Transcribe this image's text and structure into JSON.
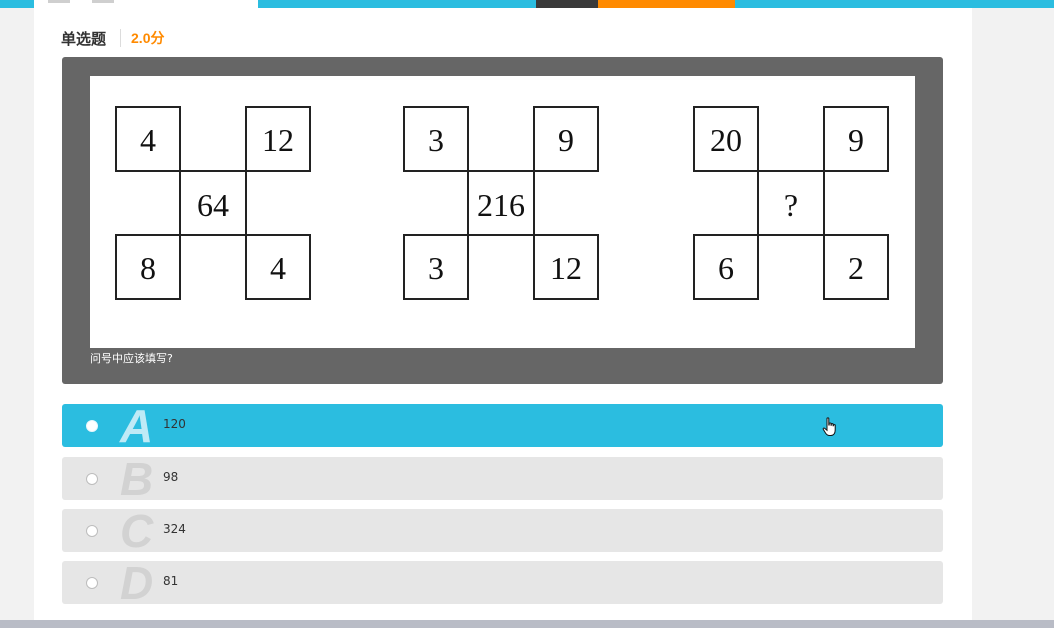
{
  "question": {
    "type_label": "单选题",
    "score": "2.0分",
    "stem_text": "问号中应该填写?"
  },
  "figure": {
    "puzzles": [
      {
        "top_left": "4",
        "top_right": "12",
        "center": "64",
        "bottom_left": "8",
        "bottom_right": "4"
      },
      {
        "top_left": "3",
        "top_right": "9",
        "center": "216",
        "bottom_left": "3",
        "bottom_right": "12"
      },
      {
        "top_left": "20",
        "top_right": "9",
        "center": "?",
        "bottom_left": "6",
        "bottom_right": "2"
      }
    ]
  },
  "options": [
    {
      "letter": "A",
      "text": "120",
      "selected": true
    },
    {
      "letter": "B",
      "text": "98",
      "selected": false
    },
    {
      "letter": "C",
      "text": "324",
      "selected": false
    },
    {
      "letter": "D",
      "text": "81",
      "selected": false
    }
  ],
  "colors": {
    "accent": "#2bbde0",
    "score": "#ff8a00",
    "stem_bg": "#666666",
    "option_bg": "#e6e6e6"
  },
  "icons": {
    "cursor": "hand-pointer-icon"
  }
}
